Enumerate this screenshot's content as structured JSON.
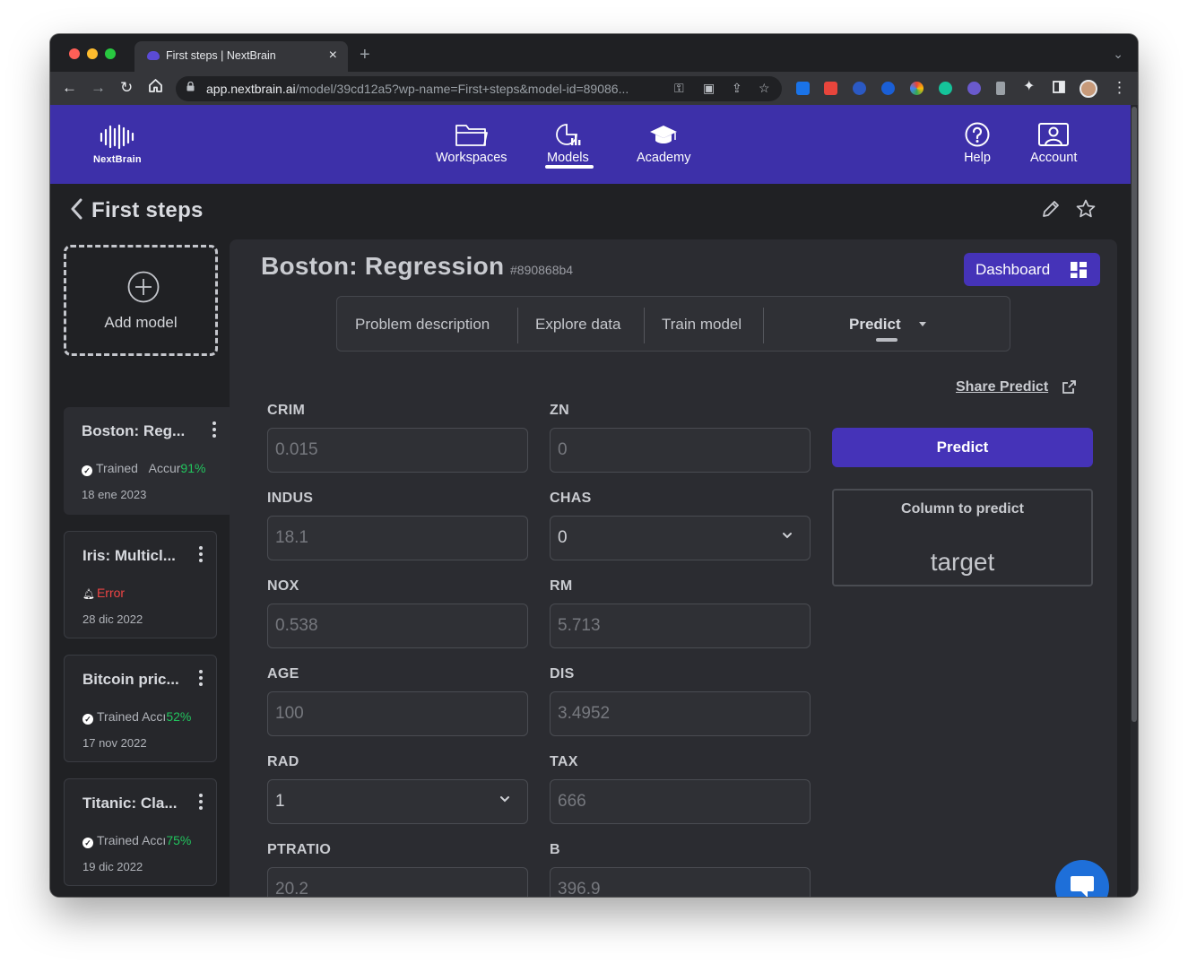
{
  "browser": {
    "tab_title": "First steps | NextBrain",
    "url_domain": "app.nextbrain.ai",
    "url_path": "/model/39cd12a5?wp-name=First+steps&model-id=89086...",
    "colors": {
      "close": "#ff5f57",
      "minimize": "#febc2e",
      "zoom": "#28c840"
    }
  },
  "nav": {
    "logo": "NextBrain",
    "items": [
      {
        "label": "Workspaces",
        "icon": "folder-icon"
      },
      {
        "label": "Models",
        "icon": "chart-icon",
        "active": true
      },
      {
        "label": "Academy",
        "icon": "graduation-cap-icon"
      },
      {
        "label": "Help",
        "icon": "help-icon"
      },
      {
        "label": "Account",
        "icon": "account-icon"
      }
    ]
  },
  "page": {
    "title": "First steps"
  },
  "sidebar": {
    "add_label": "Add model",
    "cards": [
      {
        "title": "Boston: Reg...",
        "status": "Trained",
        "acc_label": "Accur",
        "acc": "91%",
        "date": "18 ene 2023",
        "active": true
      },
      {
        "title": "Iris: Multicl...",
        "status": "Error",
        "date": "28 dic 2022"
      },
      {
        "title": "Bitcoin pric...",
        "status": "Trained",
        "acc_label": "Accı",
        "acc": "52%",
        "date": "17 nov 2022"
      },
      {
        "title": "Titanic: Cla...",
        "status": "Trained",
        "acc_label": "Accı",
        "acc": "75%",
        "date": "19 dic 2022"
      }
    ]
  },
  "model": {
    "title": "Boston: Regression",
    "id": "#890868b4",
    "dashboard_label": "Dashboard",
    "tabs": [
      "Problem description",
      "Explore data",
      "Train model",
      "Predict"
    ],
    "share_label": "Share Predict",
    "predict_label": "Predict",
    "column_label": "Column to predict",
    "column_value": "target",
    "fields": [
      {
        "label": "CRIM",
        "value": "0.015",
        "type": "input"
      },
      {
        "label": "ZN",
        "value": "0",
        "type": "input"
      },
      {
        "label": "INDUS",
        "value": "18.1",
        "type": "input"
      },
      {
        "label": "CHAS",
        "value": "0",
        "type": "select"
      },
      {
        "label": "NOX",
        "value": "0.538",
        "type": "input"
      },
      {
        "label": "RM",
        "value": "5.713",
        "type": "input"
      },
      {
        "label": "AGE",
        "value": "100",
        "type": "input"
      },
      {
        "label": "DIS",
        "value": "3.4952",
        "type": "input"
      },
      {
        "label": "RAD",
        "value": "1",
        "type": "select"
      },
      {
        "label": "TAX",
        "value": "666",
        "type": "input"
      },
      {
        "label": "PTRATIO",
        "value": "20.2",
        "type": "input"
      },
      {
        "label": "B",
        "value": "396.9",
        "type": "input"
      }
    ]
  },
  "colors": {
    "nav_bg": "#3d30a9",
    "accent": "#4533b8",
    "success": "#22c55e",
    "error": "#ef4444",
    "chat": "#1e6fd9"
  }
}
